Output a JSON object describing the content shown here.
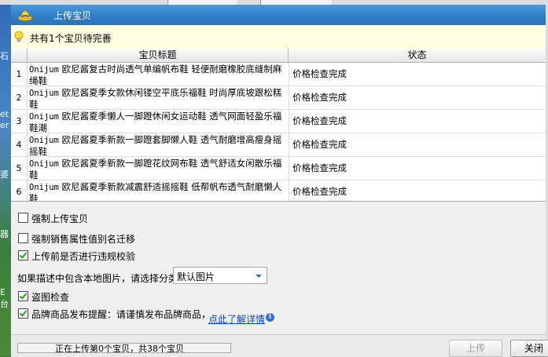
{
  "window": {
    "title": "上传宝贝"
  },
  "hint": {
    "text": "共有1个宝贝待完善"
  },
  "table": {
    "columns": [
      "宝贝标题",
      "状态"
    ],
    "rows": [
      {
        "num": "1",
        "brand": "Onijum",
        "title": "欧尼酱复古时尚透气单编帆布鞋 轻便耐磨橡胶底缝制麻绳鞋",
        "status": "价格检查完成"
      },
      {
        "num": "2",
        "brand": "Onijum",
        "title": "欧尼酱夏季女款休闲镂空平底乐福鞋 时尚厚底坡跟松糕鞋",
        "status": "价格检查完成"
      },
      {
        "num": "3",
        "brand": "Onijum",
        "title": "欧尼酱夏季懒人一脚蹬休闲女运动鞋 透气网面轻盈乐福鞋潮",
        "status": "价格检查完成"
      },
      {
        "num": "4",
        "brand": "Onijum",
        "title": "欧尼酱夏季新款一脚蹬套脚懒人鞋 透气耐磨增高瘦身摇摇鞋",
        "status": "价格检查完成"
      },
      {
        "num": "5",
        "brand": "Onijum",
        "title": "欧尼酱夏季新款一脚蹬花纹网布鞋 透气舒适女闲散乐福鞋",
        "status": "价格检查完成"
      },
      {
        "num": "6",
        "brand": "Onijum",
        "title": "欧尼酱夏季新款减震舒适摇摇鞋 低帮帆布透气耐磨懒人鞋",
        "status": "价格检查完成"
      }
    ]
  },
  "options": {
    "force_upload": {
      "label": "强制上传宝贝",
      "checked": false
    },
    "force_sales_attr": {
      "label": "强制销售属性值别名迁移",
      "checked": false
    },
    "check_violation": {
      "label": "上传前是否进行违规校验",
      "checked": true
    },
    "local_image_label": "如果描述中包含本地图片，请选择分类",
    "local_image_value": "默认图片",
    "anti_theft": {
      "label": "盗图检查",
      "checked": true
    },
    "brand_notice": {
      "label": "品牌商品发布提醒：请谨慎发布品牌商品，",
      "checked": true
    },
    "brand_link": "点此了解详情"
  },
  "footer": {
    "progress_text": "正在上传第0个宝贝，共38个宝贝",
    "progress_value": 0,
    "upload_label": "上传",
    "close_label": "关闭"
  },
  "desktop_labels": [
    "石",
    "et",
    "er",
    "婆",
    "器",
    "E台"
  ],
  "colors": {
    "titlebar": "#2f7ec8",
    "link": "#0645c8",
    "check": "#21a121"
  }
}
